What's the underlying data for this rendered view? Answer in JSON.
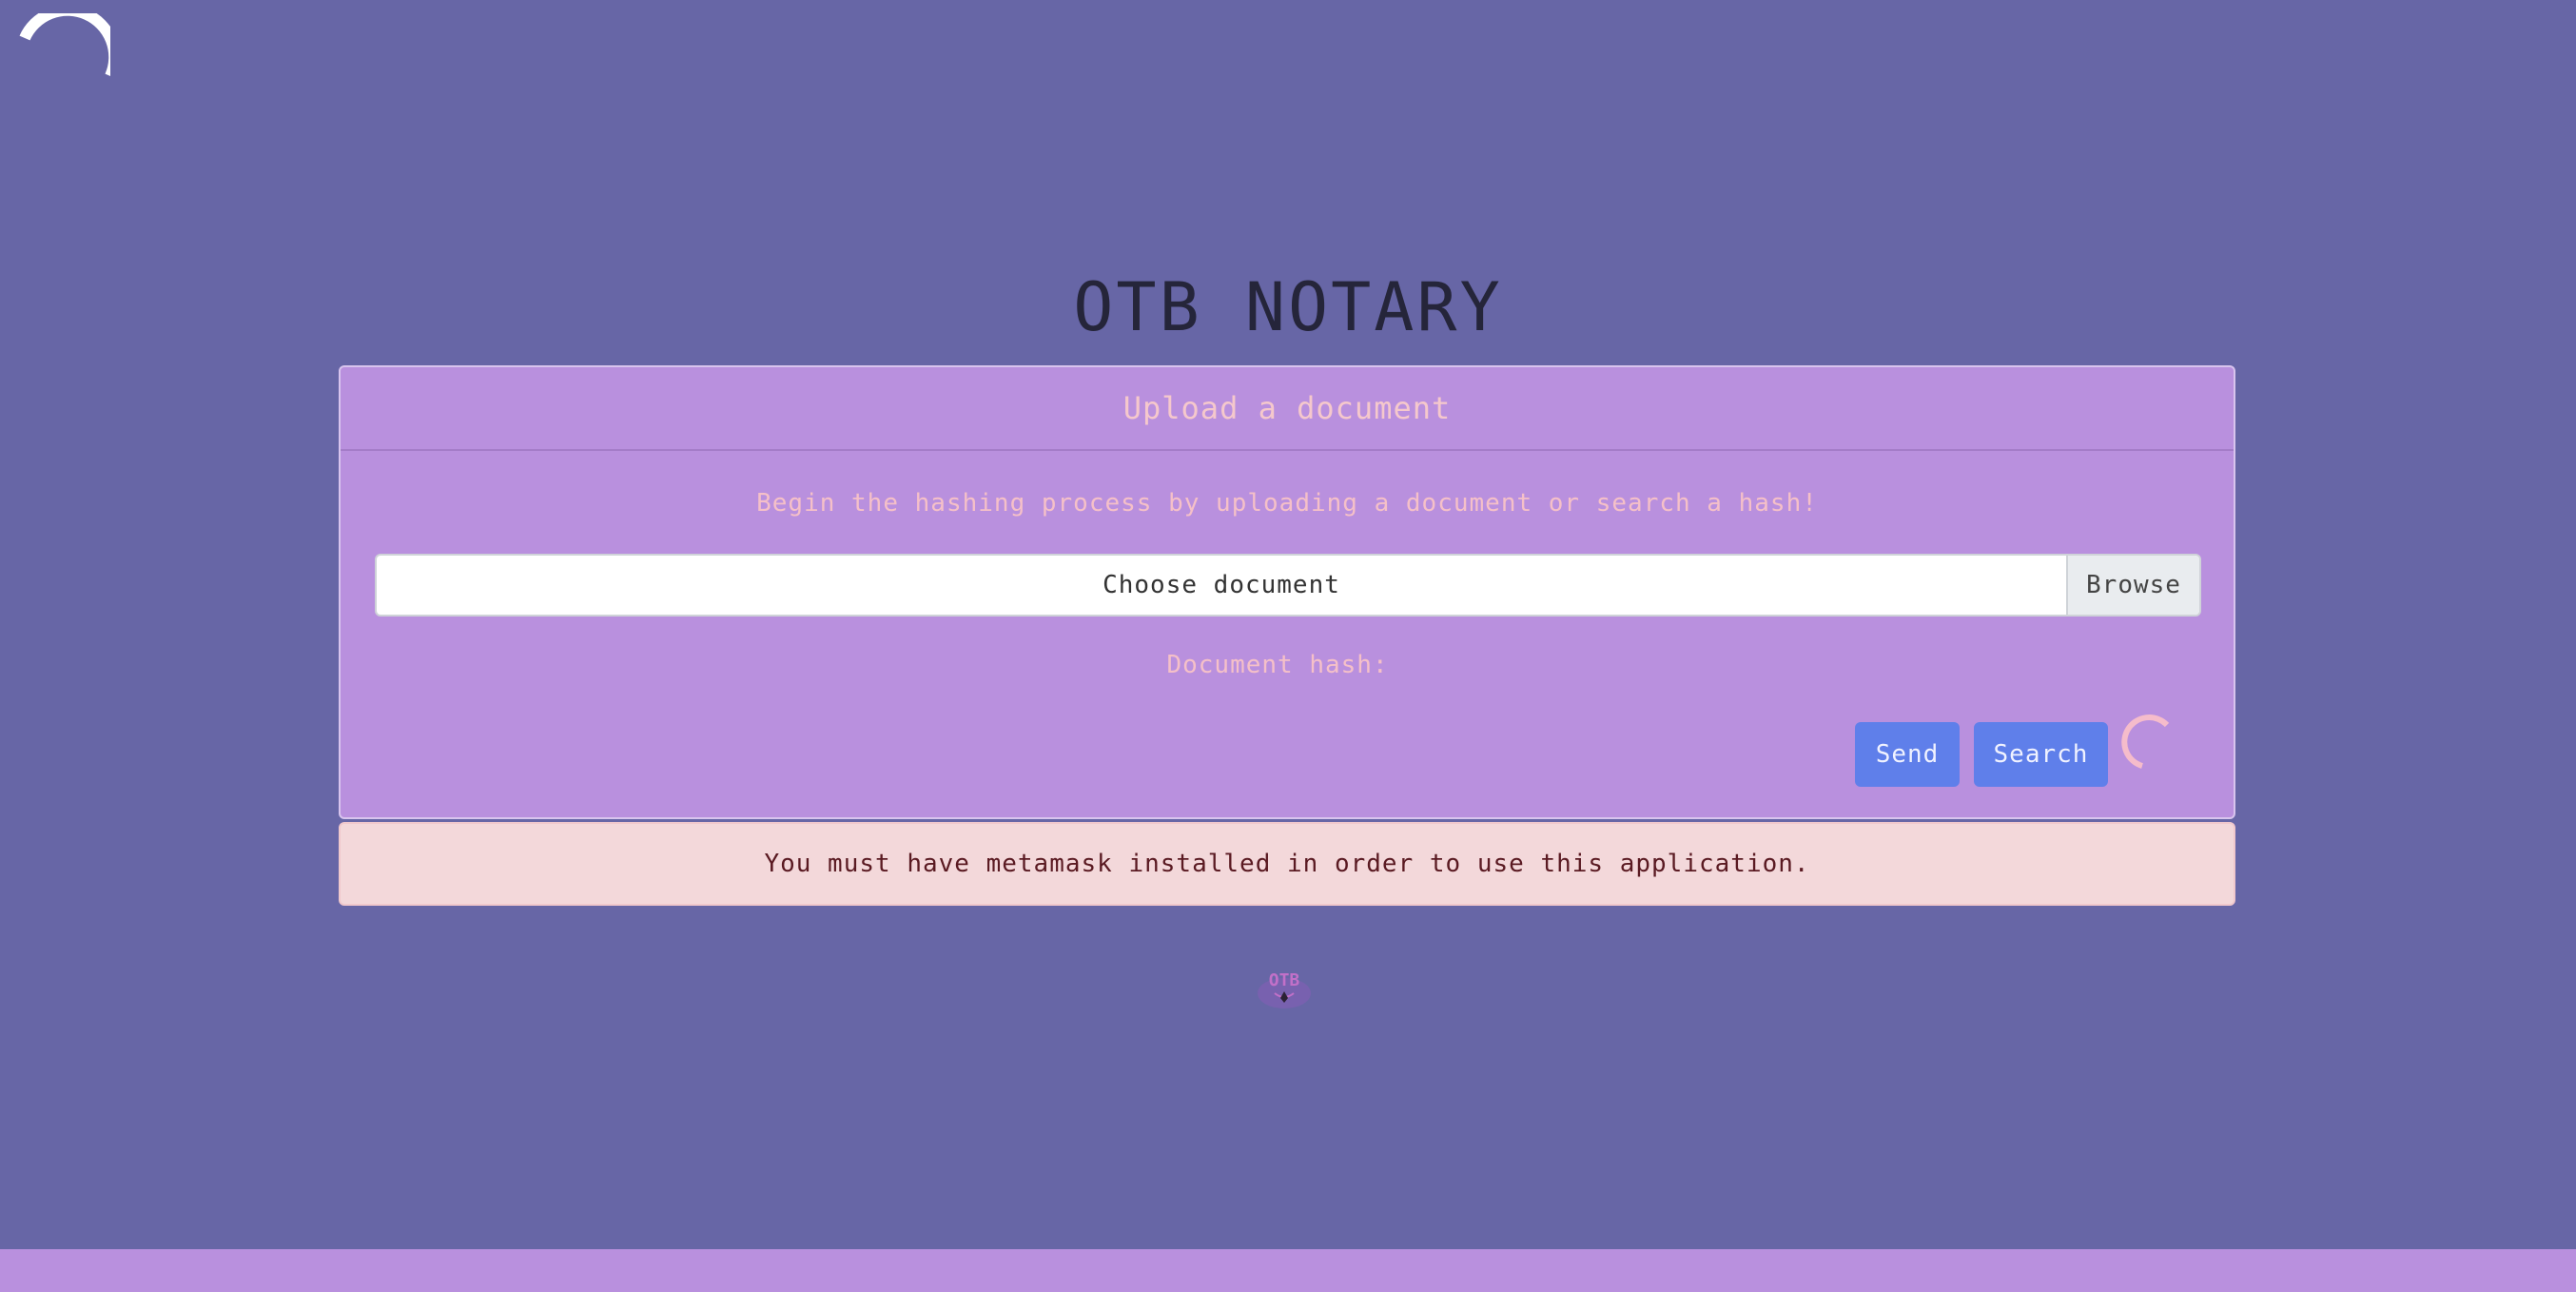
{
  "header": {
    "title": "OTB NOTARY"
  },
  "upload_card": {
    "header": "Upload a document",
    "subtitle": "Begin the hashing process by uploading a document or search a hash!",
    "file_input_label": "Choose document",
    "browse_label": "Browse",
    "hash_label": "Document hash:",
    "send_label": "Send",
    "search_label": "Search"
  },
  "alert": {
    "message": "You must have metamask installed in order to use this application."
  },
  "logo": {
    "text": "OTB"
  },
  "icons": {
    "corner": "loading-spinner-icon",
    "card": "loading-spinner-icon",
    "logo": "otb-logo"
  },
  "colors": {
    "background": "#6766a6",
    "card": "#b990de",
    "accent_text": "#f5c0c8",
    "button": "#5f7fea",
    "alert_bg": "#f3d8da",
    "alert_text": "#5a1a22"
  }
}
